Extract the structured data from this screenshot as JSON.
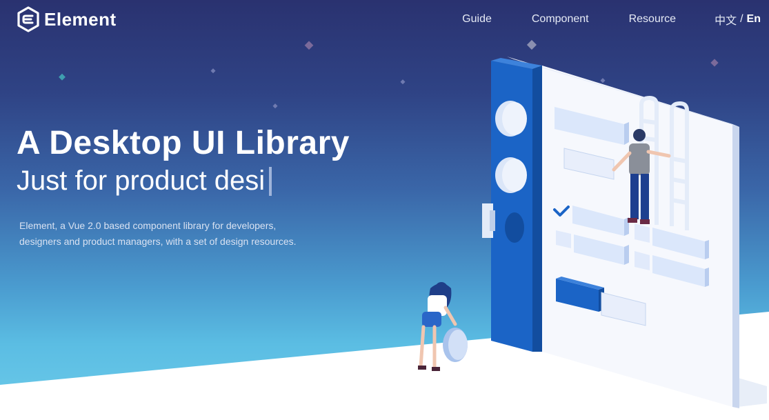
{
  "header": {
    "logo_text": "Element",
    "nav": [
      "Guide",
      "Component",
      "Resource"
    ],
    "lang_zh": "中文",
    "lang_sep": "/",
    "lang_en": "En"
  },
  "hero": {
    "title": "A Desktop UI Library",
    "subtitle": "Just for product desi",
    "description": "Element, a Vue 2.0 based component library for developers, designers and product managers, with a set of design resources."
  },
  "colors": {
    "bg_top": "#2a3270",
    "bg_bottom": "#6dcbea",
    "board_blue": "#1a63c4",
    "board_white": "#f4f7fd",
    "component_light": "#dbe7fb"
  },
  "icons": [
    "element-logo-icon",
    "checkmark-icon"
  ]
}
